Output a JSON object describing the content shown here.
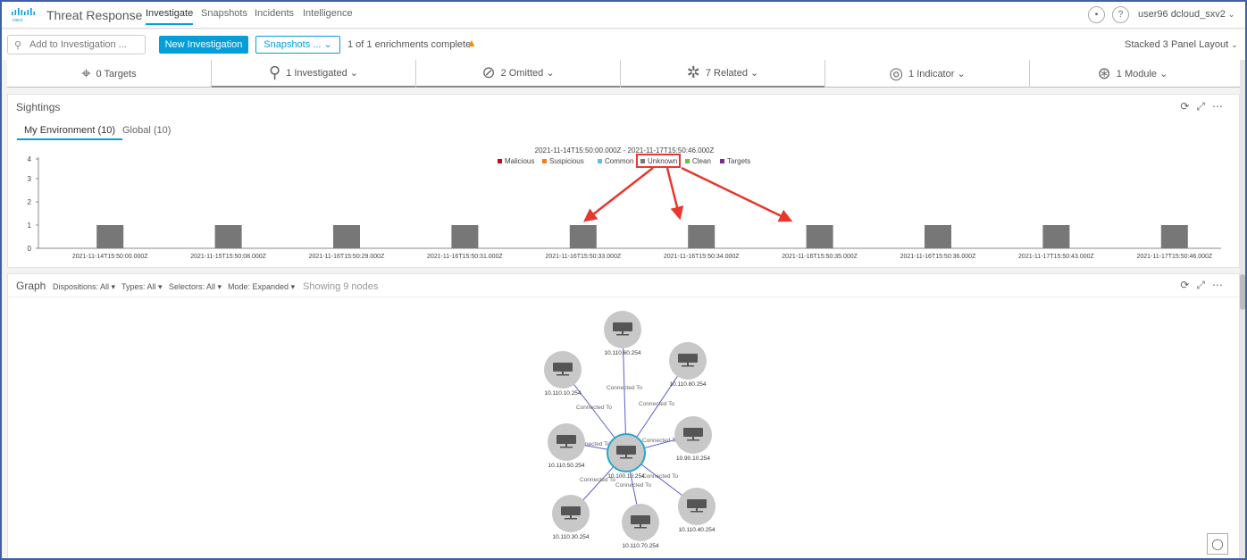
{
  "app": {
    "title": "Threat Response"
  },
  "nav": {
    "tabs": [
      "Investigate",
      "Snapshots",
      "Incidents",
      "Intelligence"
    ],
    "user": "user96 dcloud_sxv2"
  },
  "toolbar": {
    "add_placeholder": "Add to Investigation ...",
    "new_investigation": "New Investigation",
    "snapshots": "Snapshots ...",
    "enrichments": "1 of 1 enrichments complete",
    "layout": "Stacked 3 Panel Layout"
  },
  "summary": {
    "items": [
      {
        "label": "0 Targets",
        "icon": "crosshair-icon"
      },
      {
        "label": "1 Investigated",
        "icon": "search-icon"
      },
      {
        "label": "2 Omitted",
        "icon": "omit-icon"
      },
      {
        "label": "7 Related",
        "icon": "network-icon"
      },
      {
        "label": "1 Indicator",
        "icon": "fingerprint-icon"
      },
      {
        "label": "1 Module",
        "icon": "module-icon"
      }
    ]
  },
  "sightings": {
    "title": "Sightings",
    "tabs": [
      "My Environment (10)",
      "Global (10)"
    ]
  },
  "chart_data": {
    "type": "bar",
    "title": "2021-11-14T15:50:00.000Z - 2021-11-17T15:50:46.000Z",
    "legend": [
      {
        "name": "Malicious",
        "color": "#d0021b"
      },
      {
        "name": "Suspicious",
        "color": "#f47b20"
      },
      {
        "name": "Common",
        "color": "#64bbe3"
      },
      {
        "name": "Unknown",
        "color": "#777777"
      },
      {
        "name": "Clean",
        "color": "#6cc04a"
      },
      {
        "name": "Targets",
        "color": "#7b2a90"
      }
    ],
    "categories": [
      "2021-11-14T15:50:00.000Z",
      "2021-11-15T15:50:08.000Z",
      "2021-11-16T15:50:29.000Z",
      "2021-11-16T15:50:31.000Z",
      "2021-11-16T15:50:33.000Z",
      "2021-11-16T15:50:34.000Z",
      "2021-11-16T15:50:35.000Z",
      "2021-11-16T15:50:36.000Z",
      "2021-11-17T15:50:43.000Z",
      "2021-11-17T15:50:46.000Z"
    ],
    "series": [
      {
        "name": "Unknown",
        "values": [
          1,
          1,
          1,
          1,
          1,
          1,
          1,
          1,
          1,
          1
        ]
      }
    ],
    "yticks": [
      0,
      1,
      2,
      3,
      4
    ],
    "ylim": [
      0,
      4
    ],
    "legend_position": "top-center"
  },
  "graph": {
    "title": "Graph",
    "filters": [
      "Dispositions: All",
      "Types: All",
      "Selectors: All",
      "Mode: Expanded"
    ],
    "showing": "Showing 9 nodes",
    "center": "10.100.10.254",
    "edge_label": "Connected To",
    "nodes": [
      "10.110.60.254",
      "10.110.10.254",
      "10.110.80.254",
      "10.90.10.254",
      "10.110.50.254",
      "10.110.40.254",
      "10.110.70.254",
      "10.110.30.254"
    ]
  },
  "colors": {
    "accent": "#049fd9",
    "annotation": "#e8372c",
    "bar": "#777777"
  }
}
